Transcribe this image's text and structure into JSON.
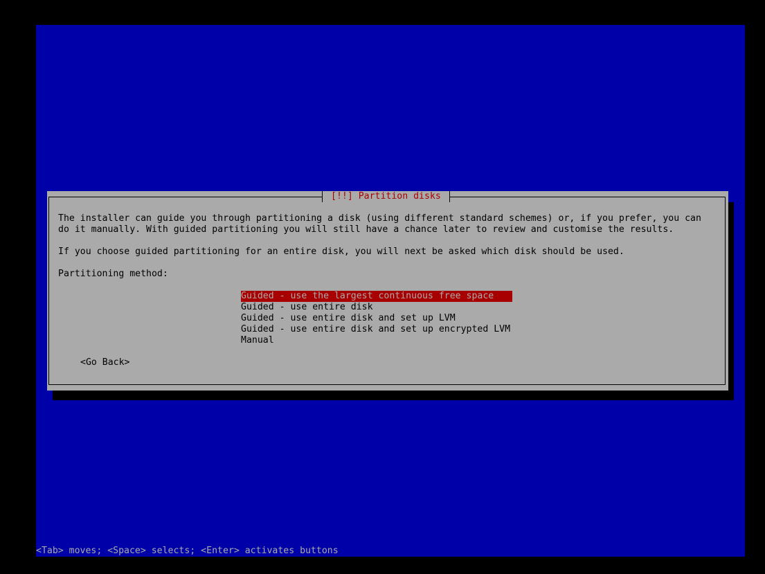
{
  "colors": {
    "screen_background": "#0000a8",
    "dialog_background": "#aaaaaa",
    "title_text": "#a80000",
    "selection_background": "#a80000",
    "status_text": "#aaaaaa"
  },
  "dialog": {
    "title": "[!!] Partition disks",
    "paragraph1_line1": "The installer can guide you through partitioning a disk (using different standard schemes) or, if you prefer, you can",
    "paragraph1_line2": "do it manually. With guided partitioning you will still have a chance later to review and customise the results.",
    "paragraph2": "If you choose guided partitioning for an entire disk, you will next be asked which disk should be used.",
    "prompt": "Partitioning method:",
    "options": [
      {
        "label": "Guided - use the largest continuous free space",
        "selected": true
      },
      {
        "label": "Guided - use entire disk",
        "selected": false
      },
      {
        "label": "Guided - use entire disk and set up LVM",
        "selected": false
      },
      {
        "label": "Guided - use entire disk and set up encrypted LVM",
        "selected": false
      },
      {
        "label": "Manual",
        "selected": false
      }
    ],
    "go_back_label": "<Go Back>"
  },
  "status_bar": {
    "text": "<Tab> moves; <Space> selects; <Enter> activates buttons"
  }
}
